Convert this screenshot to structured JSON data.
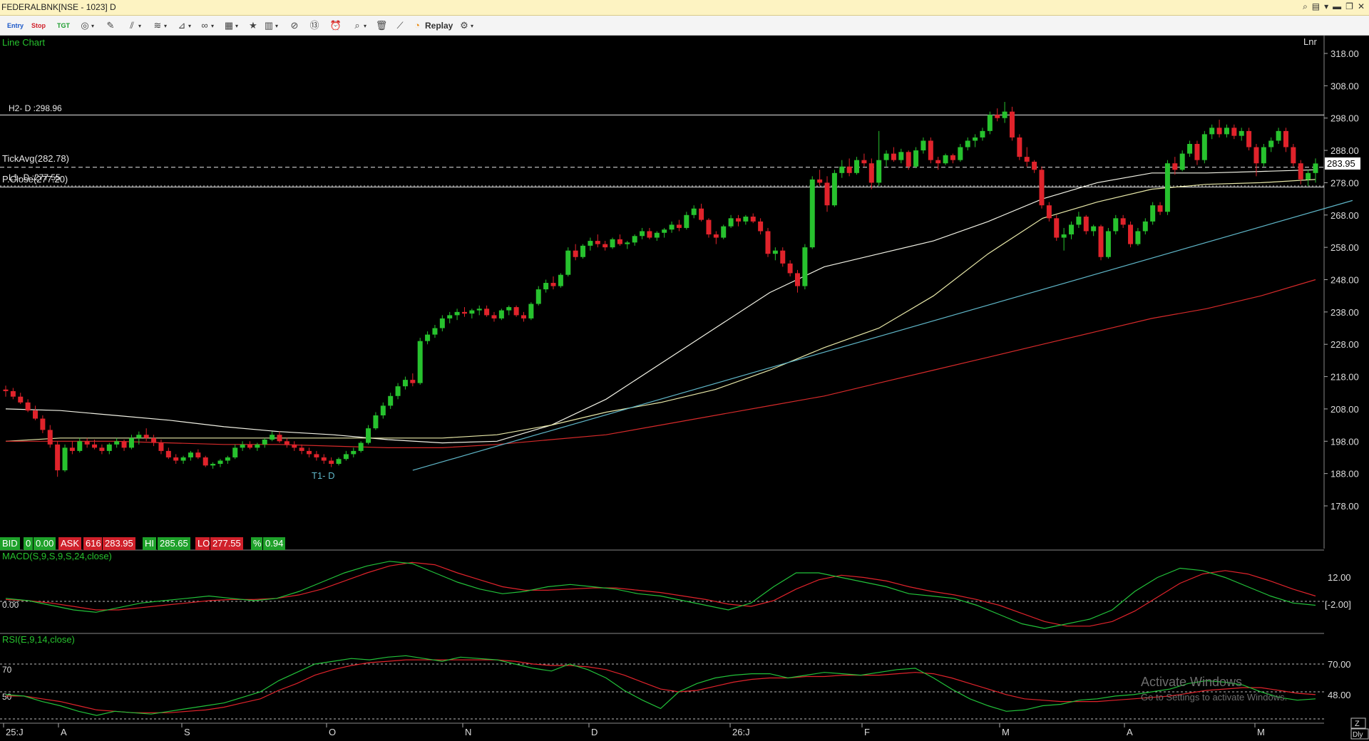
{
  "window": {
    "title": "FEDERALBNK[NSE - 1023] D"
  },
  "toolbar": {
    "entry_label": "Entry",
    "stop_label": "Stop",
    "tgt_label": "TGT",
    "replay_label": "Replay"
  },
  "colors": {
    "bull": "#27c22e",
    "bear": "#e0232b",
    "price_line_bg": "#000000",
    "ma_short": "#f2f2e6",
    "ma_mid": "#e8e8a8",
    "ma_long": "#d62a2a",
    "trendline": "#5fb6c8",
    "macd_line": "#22c23a",
    "signal_line": "#e0232b"
  },
  "chart": {
    "type_label": "Line Chart",
    "scale_label": "Lnr",
    "price_axis_ticks": [
      "318.00",
      "308.00",
      "298.00",
      "288.00",
      "278.00",
      "268.00",
      "258.00",
      "248.00",
      "238.00",
      "228.00",
      "218.00",
      "208.00",
      "198.00",
      "188.00",
      "178.00"
    ],
    "h2_label": "H2- D :298.96",
    "tickavg_label": "TickAvg(282.78)",
    "pclose_label": "P.Close(277.20)",
    "l1_label": "L1- D :277.55",
    "t1_label": "T1- D",
    "last_price": "283.95",
    "x_labels": [
      "25:J",
      "A",
      "S",
      "O",
      "N",
      "D",
      "26:J",
      "F",
      "M",
      "A",
      "M"
    ],
    "corner_button": "Z",
    "period_button": "Dly"
  },
  "quote": {
    "bid_label": "BID",
    "bid_qty": "0",
    "bid_price": "0.00",
    "ask_label": "ASK",
    "ask_qty": "616",
    "ask_price": "283.95",
    "hi_label": "HI",
    "hi_value": "285.65",
    "lo_label": "LO",
    "lo_value": "277.55",
    "pct_label": "%",
    "pct_value": "0.94"
  },
  "macd": {
    "title": "MACD(S,9,S,9,S,24,close)",
    "zero_label": "0.00",
    "ticks": [
      "12.00",
      "[-2.00]"
    ]
  },
  "rsi": {
    "title": "RSI(E,9,14,close)",
    "ticks": [
      "70.00",
      "48.00"
    ],
    "left_ticks": [
      "70",
      "50"
    ]
  },
  "overlay": {
    "activate_title": "Activate Windows",
    "activate_sub": "Go to Settings to activate Windows."
  },
  "chart_data": {
    "type": "candlestick",
    "scale": "linear",
    "ylim": [
      170,
      322
    ],
    "x_period_labels": [
      "25:J",
      "A",
      "S",
      "O",
      "N",
      "D",
      "26:J",
      "F",
      "M",
      "A",
      "M"
    ],
    "candles_ohlc": [
      [
        214,
        215.2,
        211.8,
        213.5
      ],
      [
        213.5,
        214.5,
        211,
        211.8
      ],
      [
        211.8,
        213,
        209.5,
        210
      ],
      [
        210,
        211,
        207,
        207.5
      ],
      [
        207.5,
        209,
        204.5,
        205
      ],
      [
        205,
        206,
        200.5,
        201.5
      ],
      [
        201.5,
        203,
        196,
        197
      ],
      [
        197,
        198,
        187,
        189
      ],
      [
        189,
        197,
        188.5,
        196
      ],
      [
        196,
        198,
        194,
        195
      ],
      [
        195,
        199,
        194.5,
        198
      ],
      [
        198,
        199,
        196,
        197
      ],
      [
        197,
        198.5,
        195.5,
        196
      ],
      [
        196,
        197,
        194,
        195
      ],
      [
        195,
        197.5,
        194,
        197
      ],
      [
        197,
        199,
        196,
        198
      ],
      [
        198,
        198.5,
        195,
        196
      ],
      [
        196,
        200,
        195.5,
        199
      ],
      [
        199,
        201,
        197,
        200
      ],
      [
        200,
        202,
        198,
        199
      ],
      [
        199,
        200,
        196.5,
        197.5
      ],
      [
        197.5,
        198.5,
        194,
        195
      ],
      [
        195,
        196,
        192.5,
        193
      ],
      [
        193,
        194,
        191,
        192
      ],
      [
        192,
        193.5,
        191,
        193
      ],
      [
        193,
        195,
        192,
        194.5
      ],
      [
        194.5,
        195.5,
        192.5,
        193
      ],
      [
        193,
        193.5,
        190,
        190.5
      ],
      [
        190.5,
        191.5,
        189.5,
        191
      ],
      [
        191,
        192.5,
        190,
        192
      ],
      [
        192,
        193.5,
        191,
        193
      ],
      [
        193,
        197,
        192.5,
        196
      ],
      [
        196,
        198,
        195,
        197
      ],
      [
        197,
        198,
        195.5,
        196
      ],
      [
        196,
        197.5,
        195,
        197
      ],
      [
        197,
        199,
        196,
        198.5
      ],
      [
        198.5,
        201,
        198,
        200
      ],
      [
        200,
        201,
        197.5,
        198
      ],
      [
        198,
        199,
        196,
        197
      ],
      [
        197,
        198,
        195,
        196
      ],
      [
        196,
        197,
        194,
        195
      ],
      [
        195,
        196,
        193,
        194
      ],
      [
        194,
        195,
        192,
        193
      ],
      [
        193,
        194,
        191,
        192
      ],
      [
        192,
        193,
        190,
        191
      ],
      [
        191,
        193,
        190.5,
        192.5
      ],
      [
        192.5,
        195,
        192,
        194
      ],
      [
        194,
        196,
        193,
        195
      ],
      [
        195,
        198,
        194.5,
        197.5
      ],
      [
        197.5,
        203,
        197,
        202
      ],
      [
        202,
        207,
        201.5,
        206
      ],
      [
        206,
        210,
        205,
        209
      ],
      [
        209,
        213,
        208,
        212
      ],
      [
        212,
        216,
        211,
        215
      ],
      [
        215,
        218,
        214,
        217
      ],
      [
        217,
        219,
        215,
        216
      ],
      [
        216,
        230,
        215.5,
        229
      ],
      [
        229,
        232,
        228,
        231
      ],
      [
        231,
        234,
        230,
        233
      ],
      [
        233,
        237,
        232,
        236
      ],
      [
        236,
        238,
        234.5,
        237
      ],
      [
        237,
        239,
        235.5,
        238
      ],
      [
        238,
        239.5,
        236.5,
        237.5
      ],
      [
        237.5,
        239,
        236,
        238.5
      ],
      [
        238.5,
        240,
        237,
        239
      ],
      [
        239,
        240,
        236.5,
        237
      ],
      [
        237,
        238,
        235,
        236
      ],
      [
        236,
        239,
        235.5,
        238.5
      ],
      [
        238.5,
        240,
        237,
        239.5
      ],
      [
        239.5,
        240,
        236.5,
        237
      ],
      [
        237,
        238,
        235,
        236
      ],
      [
        236,
        241,
        235.5,
        240.5
      ],
      [
        240.5,
        246,
        240,
        245
      ],
      [
        245,
        248,
        244,
        247
      ],
      [
        247,
        249,
        245,
        246
      ],
      [
        246,
        250,
        245.5,
        249.5
      ],
      [
        249.5,
        258,
        249,
        257
      ],
      [
        257,
        259,
        254,
        255
      ],
      [
        255,
        259,
        254.5,
        258.5
      ],
      [
        258.5,
        261,
        257,
        260
      ],
      [
        260,
        262,
        258,
        259
      ],
      [
        259,
        260,
        257,
        258
      ],
      [
        258,
        261,
        257.5,
        260.5
      ],
      [
        260.5,
        262,
        258.5,
        259
      ],
      [
        259,
        260,
        257.5,
        259.5
      ],
      [
        259.5,
        262,
        258.5,
        261.5
      ],
      [
        261.5,
        264,
        260.5,
        263
      ],
      [
        263,
        264,
        260.5,
        261
      ],
      [
        261,
        263,
        260,
        262.5
      ],
      [
        262.5,
        264,
        261,
        263.5
      ],
      [
        263.5,
        266,
        262.5,
        265
      ],
      [
        265,
        266.5,
        263,
        264
      ],
      [
        264,
        269,
        263.5,
        268
      ],
      [
        268,
        271,
        267,
        270
      ],
      [
        270,
        271.5,
        266,
        266.5
      ],
      [
        266.5,
        267,
        261,
        262
      ],
      [
        262,
        263,
        259,
        261
      ],
      [
        261,
        265,
        260.5,
        264.5
      ],
      [
        264.5,
        268,
        264,
        267
      ],
      [
        267,
        268,
        264.5,
        266
      ],
      [
        266,
        268,
        265,
        267.5
      ],
      [
        267.5,
        268.5,
        265.5,
        266
      ],
      [
        266,
        267,
        262,
        263
      ],
      [
        263,
        264,
        255,
        256
      ],
      [
        256,
        258,
        254,
        257
      ],
      [
        257,
        258,
        252,
        253
      ],
      [
        253,
        254,
        249,
        250
      ],
      [
        250,
        251,
        244,
        246
      ],
      [
        246,
        259,
        245,
        258
      ],
      [
        258,
        280,
        257.5,
        279
      ],
      [
        279,
        282,
        277,
        278
      ],
      [
        278,
        280,
        269,
        271
      ],
      [
        271,
        282,
        270.5,
        281
      ],
      [
        281,
        285,
        279.5,
        283
      ],
      [
        283,
        285.5,
        280,
        281
      ],
      [
        281,
        286,
        280.5,
        285
      ],
      [
        285,
        287,
        283,
        284
      ],
      [
        284,
        285.5,
        276,
        278
      ],
      [
        278,
        294,
        277,
        285
      ],
      [
        285,
        288,
        283,
        287
      ],
      [
        287,
        289,
        284.5,
        285
      ],
      [
        285,
        288.5,
        284,
        287.5
      ],
      [
        287.5,
        288,
        282,
        283
      ],
      [
        283,
        289,
        282.5,
        288
      ],
      [
        288,
        292,
        287,
        291
      ],
      [
        291,
        292,
        284,
        285
      ],
      [
        285,
        286,
        282,
        284
      ],
      [
        284,
        287,
        283.5,
        286.5
      ],
      [
        286.5,
        287,
        284,
        285
      ],
      [
        285,
        290,
        284.5,
        289
      ],
      [
        289,
        292,
        288,
        291
      ],
      [
        291,
        293,
        289,
        292
      ],
      [
        292,
        295,
        291,
        294
      ],
      [
        294,
        300,
        293,
        299
      ],
      [
        299,
        301,
        297,
        298
      ],
      [
        298,
        303,
        296.5,
        300
      ],
      [
        300,
        301.5,
        291,
        292
      ],
      [
        292,
        293,
        285,
        286
      ],
      [
        286,
        289,
        283,
        284.5
      ],
      [
        284.5,
        285,
        281,
        282
      ],
      [
        282,
        283,
        270,
        271
      ],
      [
        271,
        272,
        266,
        267
      ],
      [
        267,
        268,
        260,
        261
      ],
      [
        261,
        264,
        257,
        262
      ],
      [
        262,
        266,
        260.5,
        265
      ],
      [
        265,
        269,
        264,
        267.5
      ],
      [
        267.5,
        268,
        262,
        263
      ],
      [
        263,
        265,
        261.5,
        264.5
      ],
      [
        264.5,
        265,
        254,
        255
      ],
      [
        255,
        264,
        254.5,
        263
      ],
      [
        263,
        268,
        262,
        267
      ],
      [
        267,
        268,
        264,
        265
      ],
      [
        265,
        266,
        258,
        259
      ],
      [
        259,
        264,
        258.5,
        263
      ],
      [
        263,
        267,
        262,
        266
      ],
      [
        266,
        272,
        265,
        271
      ],
      [
        271,
        272,
        268,
        269
      ],
      [
        269,
        285,
        268,
        284
      ],
      [
        284,
        286,
        280.5,
        282
      ],
      [
        282,
        288,
        281.5,
        287
      ],
      [
        287,
        291,
        286,
        290
      ],
      [
        290,
        291,
        283.5,
        285
      ],
      [
        285,
        294,
        284,
        293
      ],
      [
        293,
        296,
        291.5,
        295
      ],
      [
        295,
        297.5,
        292,
        293
      ],
      [
        293,
        296,
        292,
        295
      ],
      [
        295,
        296,
        291.5,
        292.5
      ],
      [
        292.5,
        295,
        291,
        294
      ],
      [
        294,
        295,
        288,
        289
      ],
      [
        289,
        290,
        280,
        284
      ],
      [
        284,
        290,
        283,
        289
      ],
      [
        289,
        292,
        287.5,
        291
      ],
      [
        291,
        295,
        290,
        294
      ],
      [
        294,
        295,
        287.5,
        289
      ],
      [
        289,
        290,
        283,
        284
      ],
      [
        284,
        285,
        277.5,
        279
      ],
      [
        279,
        282,
        277,
        281
      ],
      [
        281,
        285.5,
        278,
        283.95
      ]
    ],
    "moving_averages": [
      {
        "color": "ma_short",
        "values": [
          208,
          207.5,
          206,
          204.5,
          202.5,
          201,
          200,
          198.5,
          197.5,
          198,
          203,
          211,
          222,
          233,
          244,
          252,
          256,
          260,
          266,
          273,
          278,
          281,
          281,
          281.5,
          282
        ]
      },
      {
        "color": "ma_mid",
        "values": [
          198,
          199,
          199,
          199,
          199,
          199,
          199,
          199,
          199,
          200,
          203,
          207,
          210,
          214,
          220,
          227,
          233,
          243,
          256,
          267,
          272,
          276,
          277.5,
          278,
          279
        ]
      },
      {
        "color": "ma_long",
        "values": [
          198,
          198,
          198,
          197.5,
          197,
          197,
          196.5,
          196,
          196,
          197,
          198.5,
          200,
          203,
          206,
          209,
          212,
          216,
          220,
          224,
          228,
          232,
          236,
          239,
          243,
          248
        ]
      }
    ],
    "trendline_T1": {
      "x_start_index": 55,
      "start": 189,
      "x_end_index": 182,
      "end": 272.5
    },
    "horizontal_levels": {
      "H2": 298.96,
      "TickAvg": 282.78,
      "PClose": 277.2,
      "L1": 277.55,
      "Last": 283.95
    },
    "macd": {
      "range": [
        -12,
        20
      ],
      "macd_line": [
        1,
        0,
        -2,
        -4,
        -5,
        -3,
        -1,
        0,
        1,
        2,
        1,
        0,
        1,
        4,
        8,
        12,
        15,
        17,
        16,
        12,
        8,
        5,
        3,
        4,
        6,
        7,
        6,
        5,
        3,
        2,
        0,
        -2,
        -4,
        -1,
        6,
        12,
        12,
        10,
        8,
        6,
        3,
        2,
        1,
        -2,
        -6,
        -10,
        -12,
        -10,
        -8,
        -4,
        4,
        10,
        14,
        13,
        10,
        6,
        2,
        -1,
        -2
      ],
      "signal_line": [
        0.5,
        0,
        -1,
        -2.5,
        -4,
        -4,
        -3,
        -2,
        -1,
        0,
        0.5,
        0.5,
        1,
        2.5,
        5,
        8.5,
        12,
        15,
        16.5,
        15.5,
        12,
        9,
        6,
        4.5,
        4.5,
        5,
        5.5,
        5.5,
        4.5,
        3.5,
        2,
        0.5,
        -1.5,
        -2.5,
        0,
        5,
        9,
        11,
        10,
        8.5,
        6,
        4,
        2.5,
        0.5,
        -2,
        -5.5,
        -9,
        -11,
        -11,
        -9,
        -4.5,
        1.5,
        7.5,
        11.5,
        13,
        11.5,
        8.5,
        5,
        2
      ]
    },
    "rsi": {
      "range": [
        30,
        80
      ],
      "rsi_line": [
        48,
        47,
        43,
        40,
        36,
        33,
        36,
        35,
        34,
        36,
        38,
        40,
        42,
        46,
        50,
        58,
        64,
        70,
        72,
        74,
        73,
        75,
        76,
        74,
        72,
        75,
        74,
        73,
        70,
        67,
        65,
        70,
        66,
        60,
        51,
        44,
        38,
        50,
        56,
        60,
        62,
        63,
        63,
        60,
        62,
        64,
        63,
        62,
        64,
        66,
        67,
        60,
        52,
        45,
        40,
        36,
        37,
        40,
        41,
        44,
        45,
        47,
        48,
        50,
        52,
        56,
        58,
        57,
        55,
        50,
        46,
        44,
        45
      ],
      "signal_line": [
        47,
        47,
        45,
        43,
        40,
        37,
        36,
        35,
        35,
        35,
        36,
        37,
        39,
        42,
        45,
        51,
        56,
        62,
        66,
        69,
        71,
        72,
        73,
        73,
        73,
        73,
        73,
        73,
        72,
        70,
        69,
        69,
        68,
        66,
        62,
        57,
        52,
        50,
        51,
        54,
        57,
        59,
        60,
        60,
        61,
        61,
        62,
        62,
        62,
        63,
        64,
        63,
        60,
        56,
        52,
        48,
        45,
        44,
        43,
        43,
        43,
        44,
        45,
        46,
        47,
        49,
        51,
        52,
        53,
        53,
        51,
        49,
        48
      ]
    }
  }
}
